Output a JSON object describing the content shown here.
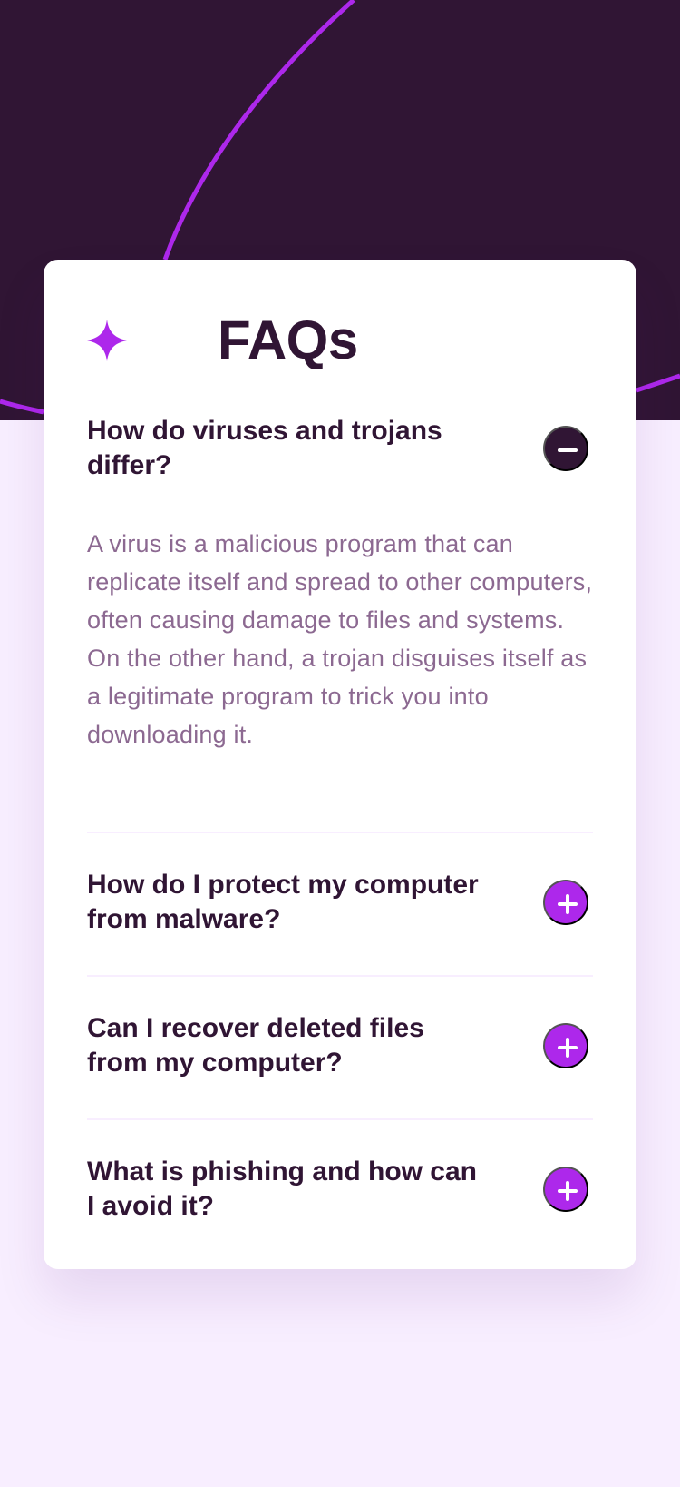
{
  "colors": {
    "hero_background": "#301534",
    "page_background": "#F8EEFF",
    "accent": "#AD28EB",
    "heading": "#301534",
    "answer_text": "#8C6991",
    "card": "#FFFFFF"
  },
  "faq": {
    "title": "FAQs",
    "icon": "star-icon",
    "items": [
      {
        "question": "How do viruses and trojans differ?",
        "answer": "A virus is a malicious program that can replicate itself and spread to other computers, often causing damage to files and systems. On the other hand, a trojan disguises itself as a legitimate program to trick you into downloading it.",
        "expanded": true,
        "toggle_icon": "minus-icon"
      },
      {
        "question": "How do I protect my computer from malware?",
        "expanded": false,
        "toggle_icon": "plus-icon"
      },
      {
        "question": "Can I recover deleted files from my computer?",
        "expanded": false,
        "toggle_icon": "plus-icon"
      },
      {
        "question": "What is phishing and how can I avoid it?",
        "expanded": false,
        "toggle_icon": "plus-icon"
      }
    ]
  }
}
